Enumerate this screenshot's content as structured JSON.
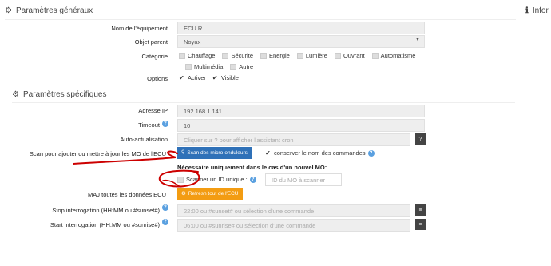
{
  "general": {
    "title": "Paramètres généraux",
    "info_title": "Infor",
    "name_label": "Nom de l'équipement",
    "name_value": "ECU R",
    "parent_label": "Objet parent",
    "parent_value": "Noyax",
    "category_label": "Catégorie",
    "categories_row1": [
      "Chauffage",
      "Sécurité",
      "Energie",
      "Lumière",
      "Ouvrant",
      "Automatisme"
    ],
    "categories_row2": [
      "Multimédia",
      "Autre"
    ],
    "options_label": "Options",
    "option_activate": "Activer",
    "option_visible": "Visible"
  },
  "specific": {
    "title": "Paramètres spécifiques",
    "ip_label": "Adresse IP",
    "ip_value": "192.168.1.141",
    "timeout_label": "Timeout",
    "timeout_value": "10",
    "autoact_label": "Auto-actualisation",
    "autoact_placeholder": "Cliquer sur ? pour afficher l'assistant cron",
    "scan_label": "Scan pour ajouter ou mettre à jour les MO de l'ECU",
    "scan_button": "Scan des micro-onduleurs",
    "keep_names": "conserver le nom des commandes",
    "new_mo_note": "Nécessaire uniquement dans le cas d'un nouvel MO:",
    "scan_single": "Scanner un ID unique :",
    "mo_id_placeholder": "ID du MO à scanner",
    "maj_label": "MAJ toutes les données ECU",
    "refresh_button": "Refresh tout de l'ECU",
    "stop_label": "Stop interrogation (HH:MM ou #sunset#)",
    "stop_placeholder": "22:00 ou #sunset# ou sélection d'une commande",
    "start_label": "Start interrogation (HH:MM ou #sunrise#)",
    "start_placeholder": "06:00 ou #sunrise# ou sélection d'une commande"
  },
  "icons": {
    "help": "?",
    "gear": "⚙",
    "gears": "⚙",
    "info": "ℹ",
    "search": "🔍",
    "list": "≡"
  },
  "colors": {
    "blue_button": "#2f71b8",
    "orange_button": "#f39c12",
    "help_icon": "#5aa0e0",
    "annotation": "#cc0000"
  }
}
